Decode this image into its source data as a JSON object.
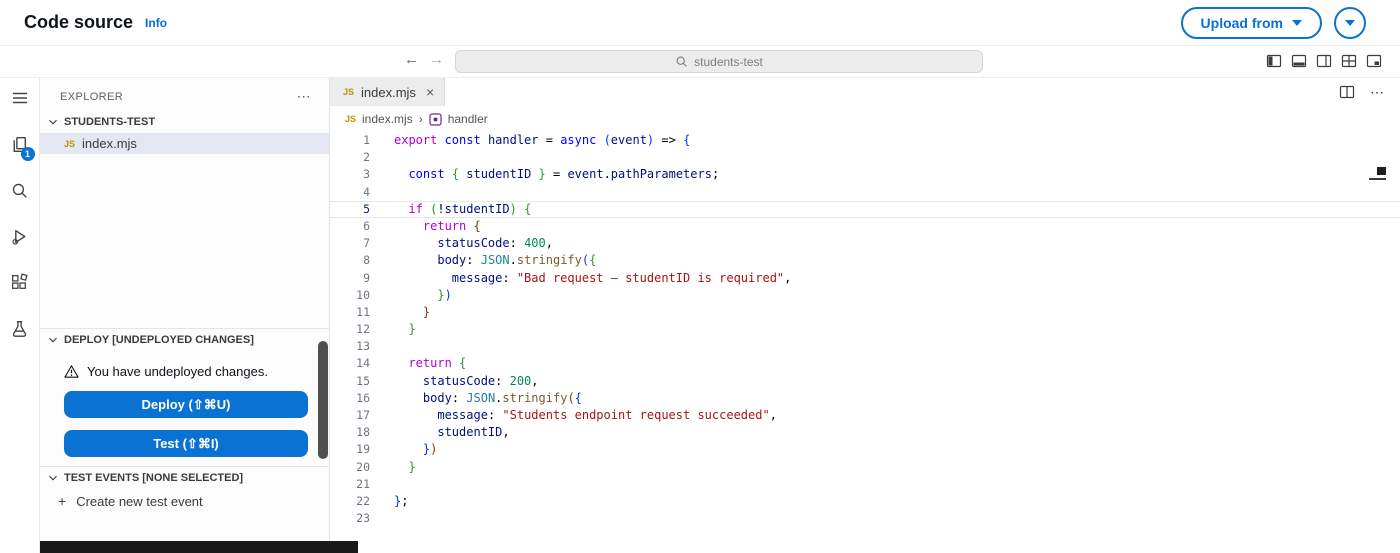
{
  "colors": {
    "accent": "#0972d3",
    "info_link": "#006ce0",
    "selection_bg": "#e4e6f1",
    "badge_bg": "#0972d3",
    "token": {
      "kwp": "#AF00DB",
      "kwb": "#0000FF",
      "var": "#001080",
      "fn": "#795E26",
      "cls": "#267F99",
      "str": "#A31515",
      "num": "#098658",
      "pun": "#000000",
      "b1": "#0431FA",
      "b2": "#319331",
      "b3": "#7B3814"
    }
  },
  "ui": {
    "ellipsis": "⋯",
    "plus": "+",
    "back_arrow": "←",
    "forward_arrow": "→"
  },
  "header": {
    "title": "Code source",
    "info_link": "Info",
    "upload_button_label": "Upload from"
  },
  "toolbar": {
    "search_value": "students-test",
    "icons": [
      "back-arrow",
      "forward-arrow",
      "search",
      "toggle-primary-sidebar",
      "toggle-panel",
      "toggle-secondary-sidebar",
      "editor-grid-layout",
      "customize-layout"
    ]
  },
  "activity_bar": {
    "items": [
      {
        "icon": "menu"
      },
      {
        "icon": "explorer-files",
        "badge": "1"
      },
      {
        "icon": "search"
      },
      {
        "icon": "run-debug"
      },
      {
        "icon": "extensions"
      },
      {
        "icon": "test-flask"
      }
    ]
  },
  "sidebar": {
    "panel_title": "EXPLORER",
    "sections": {
      "project": {
        "label": "STUDENTS-TEST"
      },
      "deploy": {
        "label": "DEPLOY [UNDEPLOYED CHANGES]"
      },
      "test_events": {
        "label": "TEST EVENTS [NONE SELECTED]"
      }
    },
    "file_item": {
      "icon": "JS",
      "label": "index.mjs"
    },
    "warning_text": "You have undeployed changes.",
    "deploy_button_label": "Deploy (⇧⌘U)",
    "test_button_label": "Test (⇧⌘I)",
    "create_test_event_label": "Create new test event"
  },
  "editor": {
    "tab": {
      "icon": "JS",
      "label": "index.mjs",
      "close": "×"
    },
    "breadcrumb": {
      "file_icon": "JS",
      "file": "index.mjs",
      "separator": "›",
      "symbol": "handler"
    },
    "active_line": 5,
    "lines": [
      [
        [
          "export ",
          "kwp"
        ],
        [
          "const ",
          "kwb"
        ],
        [
          "handler",
          "var"
        ],
        [
          " = ",
          "pun"
        ],
        [
          "async ",
          "kwb"
        ],
        [
          "(",
          "b1"
        ],
        [
          "event",
          "var"
        ],
        [
          ")",
          "b1"
        ],
        [
          " => ",
          "pun"
        ],
        [
          "{",
          "b1"
        ]
      ],
      [],
      [
        [
          "  ",
          "pun"
        ],
        [
          "const ",
          "kwb"
        ],
        [
          "{ ",
          "b2"
        ],
        [
          "studentID",
          "var"
        ],
        [
          " }",
          "b2"
        ],
        [
          " = ",
          "pun"
        ],
        [
          "event",
          "var"
        ],
        [
          ".",
          "pun"
        ],
        [
          "pathParameters",
          "var"
        ],
        [
          ";",
          "pun"
        ]
      ],
      [],
      [
        [
          "  ",
          "pun"
        ],
        [
          "if ",
          "kwp"
        ],
        [
          "(",
          "b2"
        ],
        [
          "!",
          "pun"
        ],
        [
          "studentID",
          "var"
        ],
        [
          ")",
          "b2"
        ],
        [
          " ",
          "pun"
        ],
        [
          "{",
          "b2"
        ]
      ],
      [
        [
          "    ",
          "pun"
        ],
        [
          "return ",
          "kwp"
        ],
        [
          "{",
          "b3"
        ]
      ],
      [
        [
          "      ",
          "pun"
        ],
        [
          "statusCode",
          "var"
        ],
        [
          ": ",
          "pun"
        ],
        [
          "400",
          "num"
        ],
        [
          ",",
          "pun"
        ]
      ],
      [
        [
          "      ",
          "pun"
        ],
        [
          "body",
          "var"
        ],
        [
          ": ",
          "pun"
        ],
        [
          "JSON",
          "cls"
        ],
        [
          ".",
          "pun"
        ],
        [
          "stringify",
          "fn"
        ],
        [
          "(",
          "b1"
        ],
        [
          "{",
          "b2"
        ]
      ],
      [
        [
          "        ",
          "pun"
        ],
        [
          "message",
          "var"
        ],
        [
          ": ",
          "pun"
        ],
        [
          "\"Bad request – studentID is required\"",
          "str"
        ],
        [
          ",",
          "pun"
        ]
      ],
      [
        [
          "      ",
          "pun"
        ],
        [
          "}",
          "b2"
        ],
        [
          ")",
          "b1"
        ]
      ],
      [
        [
          "    ",
          "pun"
        ],
        [
          "}",
          "b3"
        ]
      ],
      [
        [
          "  ",
          "pun"
        ],
        [
          "}",
          "b2"
        ]
      ],
      [],
      [
        [
          "  ",
          "pun"
        ],
        [
          "return ",
          "kwp"
        ],
        [
          "{",
          "b2"
        ]
      ],
      [
        [
          "    ",
          "pun"
        ],
        [
          "statusCode",
          "var"
        ],
        [
          ": ",
          "pun"
        ],
        [
          "200",
          "num"
        ],
        [
          ",",
          "pun"
        ]
      ],
      [
        [
          "    ",
          "pun"
        ],
        [
          "body",
          "var"
        ],
        [
          ": ",
          "pun"
        ],
        [
          "JSON",
          "cls"
        ],
        [
          ".",
          "pun"
        ],
        [
          "stringify",
          "fn"
        ],
        [
          "(",
          "b3"
        ],
        [
          "{",
          "b1"
        ]
      ],
      [
        [
          "      ",
          "pun"
        ],
        [
          "message",
          "var"
        ],
        [
          ": ",
          "pun"
        ],
        [
          "\"Students endpoint request succeeded\"",
          "str"
        ],
        [
          ",",
          "pun"
        ]
      ],
      [
        [
          "      ",
          "pun"
        ],
        [
          "studentID",
          "var"
        ],
        [
          ",",
          "pun"
        ]
      ],
      [
        [
          "    ",
          "pun"
        ],
        [
          "}",
          "b1"
        ],
        [
          ")",
          "b3"
        ]
      ],
      [
        [
          "  ",
          "pun"
        ],
        [
          "}",
          "b2"
        ]
      ],
      [],
      [
        [
          "}",
          "b1"
        ],
        [
          ";",
          "pun"
        ]
      ],
      []
    ]
  }
}
